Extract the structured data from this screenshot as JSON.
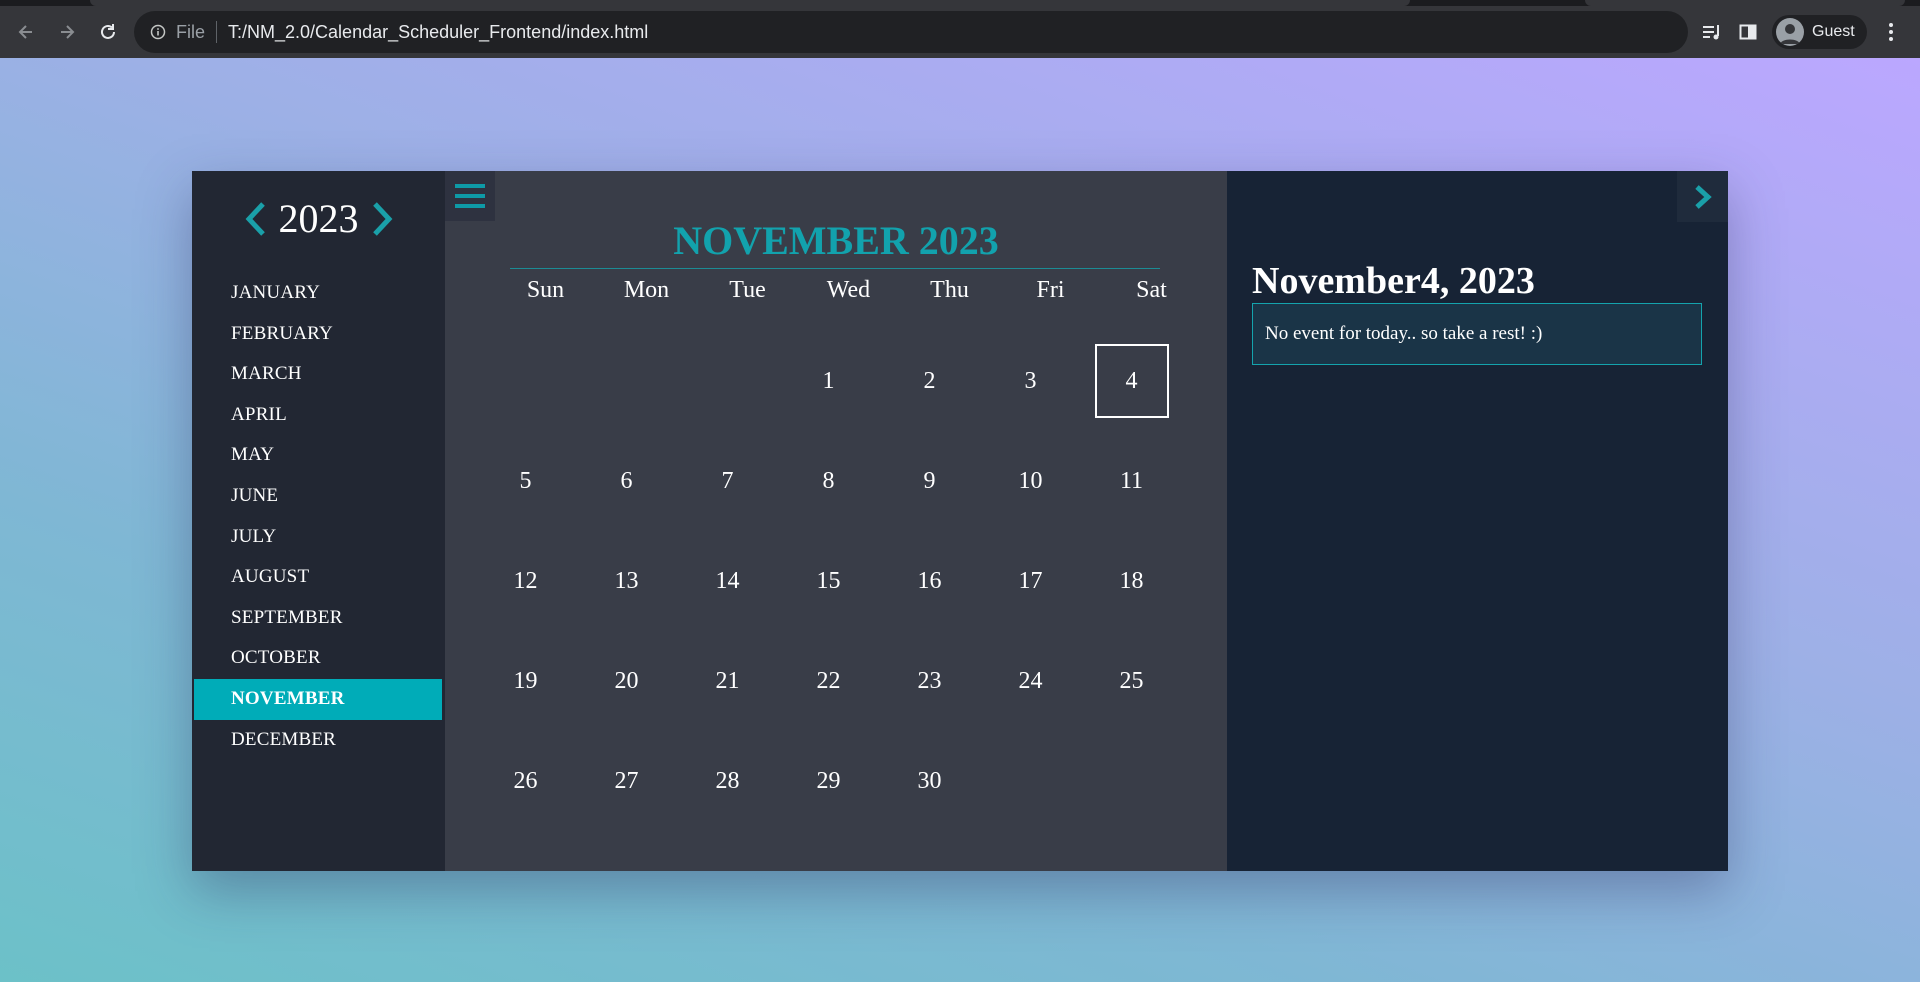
{
  "browser": {
    "file_label": "File",
    "url": "T:/NM_2.0/Calendar_Scheduler_Frontend/index.html",
    "profile_name": "Guest"
  },
  "colors": {
    "accent": "#00acb8",
    "sidebar_bg": "#222733",
    "calendar_bg": "#393d48",
    "events_bg": "#172335"
  },
  "sidebar": {
    "year": "2023",
    "months": [
      {
        "label": "JANUARY",
        "active": false
      },
      {
        "label": "FEBRUARY",
        "active": false
      },
      {
        "label": "MARCH",
        "active": false
      },
      {
        "label": "APRIL",
        "active": false
      },
      {
        "label": "MAY",
        "active": false
      },
      {
        "label": "JUNE",
        "active": false
      },
      {
        "label": "JULY",
        "active": false
      },
      {
        "label": "AUGUST",
        "active": false
      },
      {
        "label": "SEPTEMBER",
        "active": false
      },
      {
        "label": "OCTOBER",
        "active": false
      },
      {
        "label": "NOVEMBER",
        "active": true
      },
      {
        "label": "DECEMBER",
        "active": false
      }
    ]
  },
  "calendar": {
    "title": "NOVEMBER 2023",
    "weekdays": [
      "Sun",
      "Mon",
      "Tue",
      "Wed",
      "Thu",
      "Fri",
      "Sat"
    ],
    "first_weekday_index": 3,
    "days_in_month": 30,
    "selected_day": 4
  },
  "events_panel": {
    "date_heading": "November4, 2023",
    "message": "No event for today.. so take a rest! :)"
  }
}
